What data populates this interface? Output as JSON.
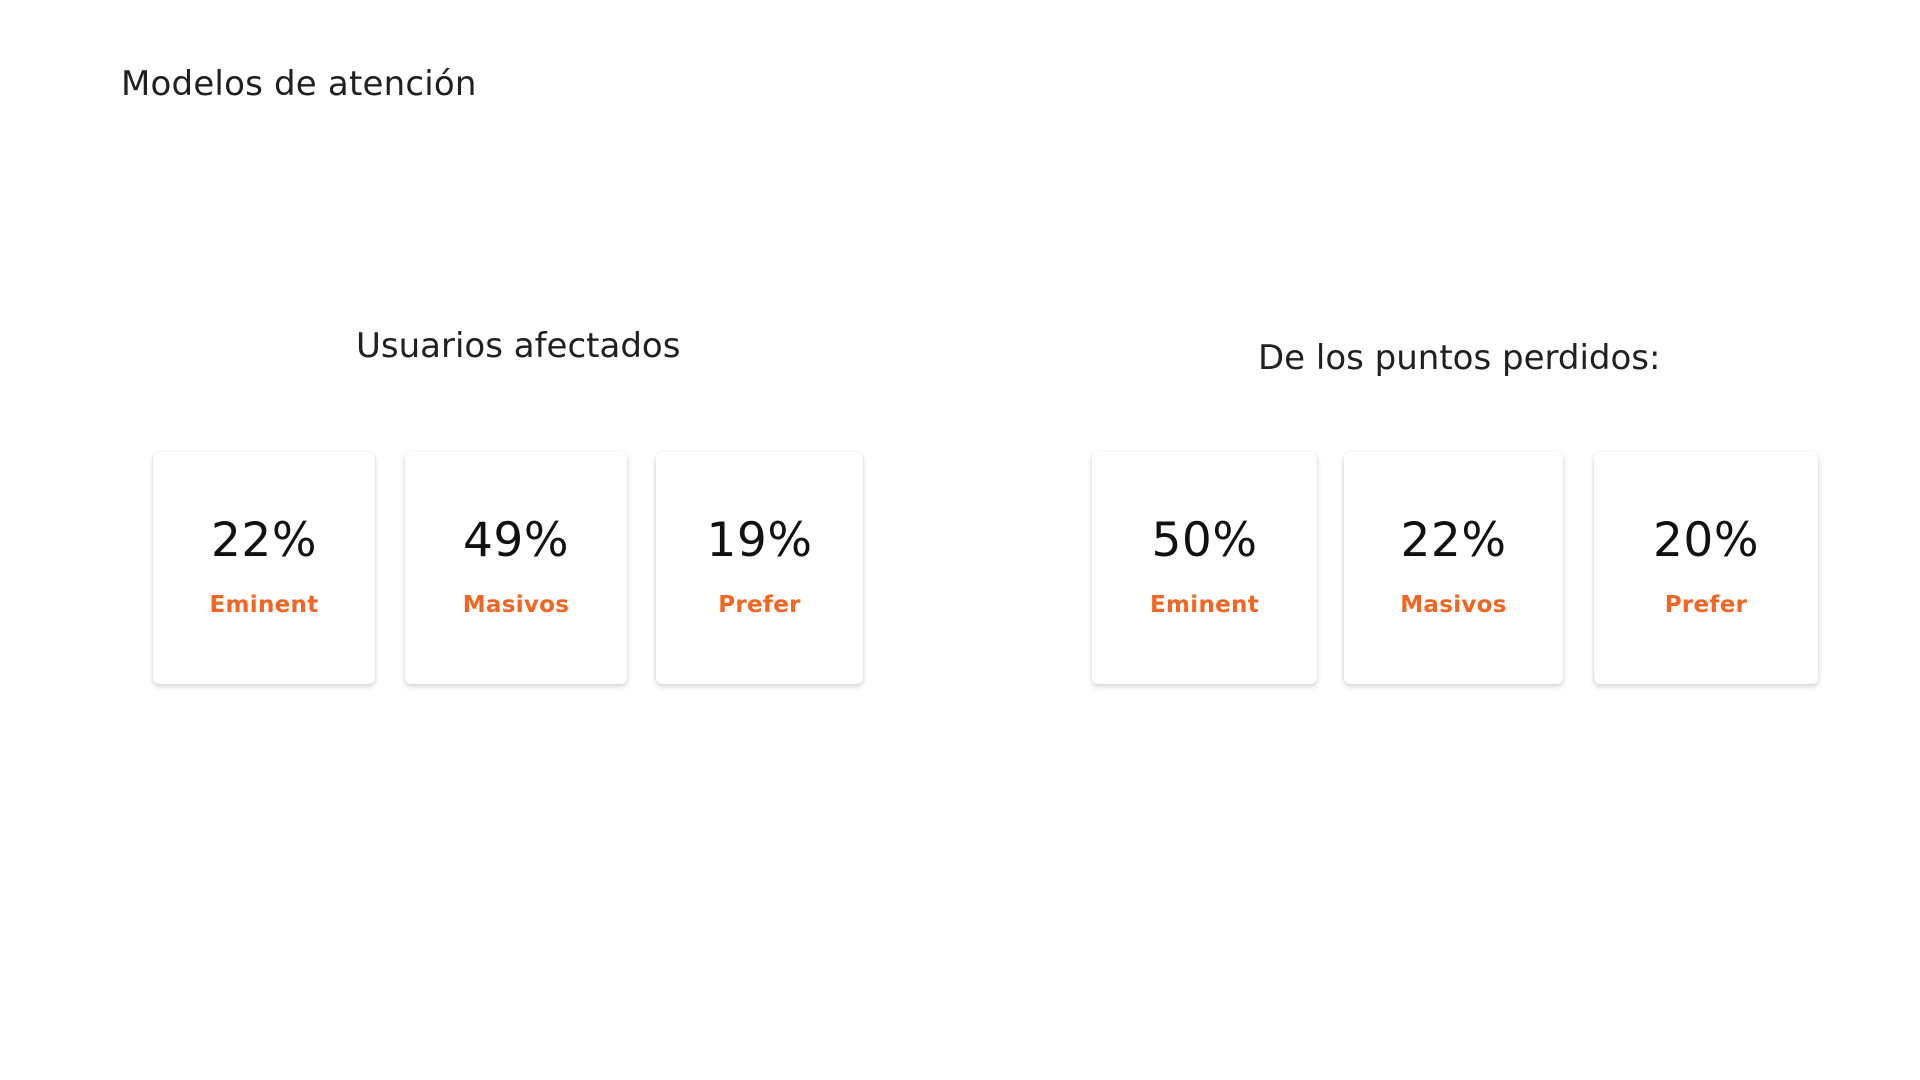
{
  "page": {
    "title": "Modelos de atención"
  },
  "sections": [
    {
      "title": "Usuarios afectados",
      "cards": [
        {
          "value": "22%",
          "label": "Eminent"
        },
        {
          "value": "49%",
          "label": "Masivos"
        },
        {
          "value": "19%",
          "label": "Prefer"
        }
      ]
    },
    {
      "title": "De los puntos perdidos:",
      "cards": [
        {
          "value": "50%",
          "label": "Eminent"
        },
        {
          "value": "22%",
          "label": "Masivos"
        },
        {
          "value": "20%",
          "label": "Prefer"
        }
      ]
    }
  ],
  "colors": {
    "accent": "#f26522",
    "text": "#202020",
    "background": "#ffffff"
  }
}
